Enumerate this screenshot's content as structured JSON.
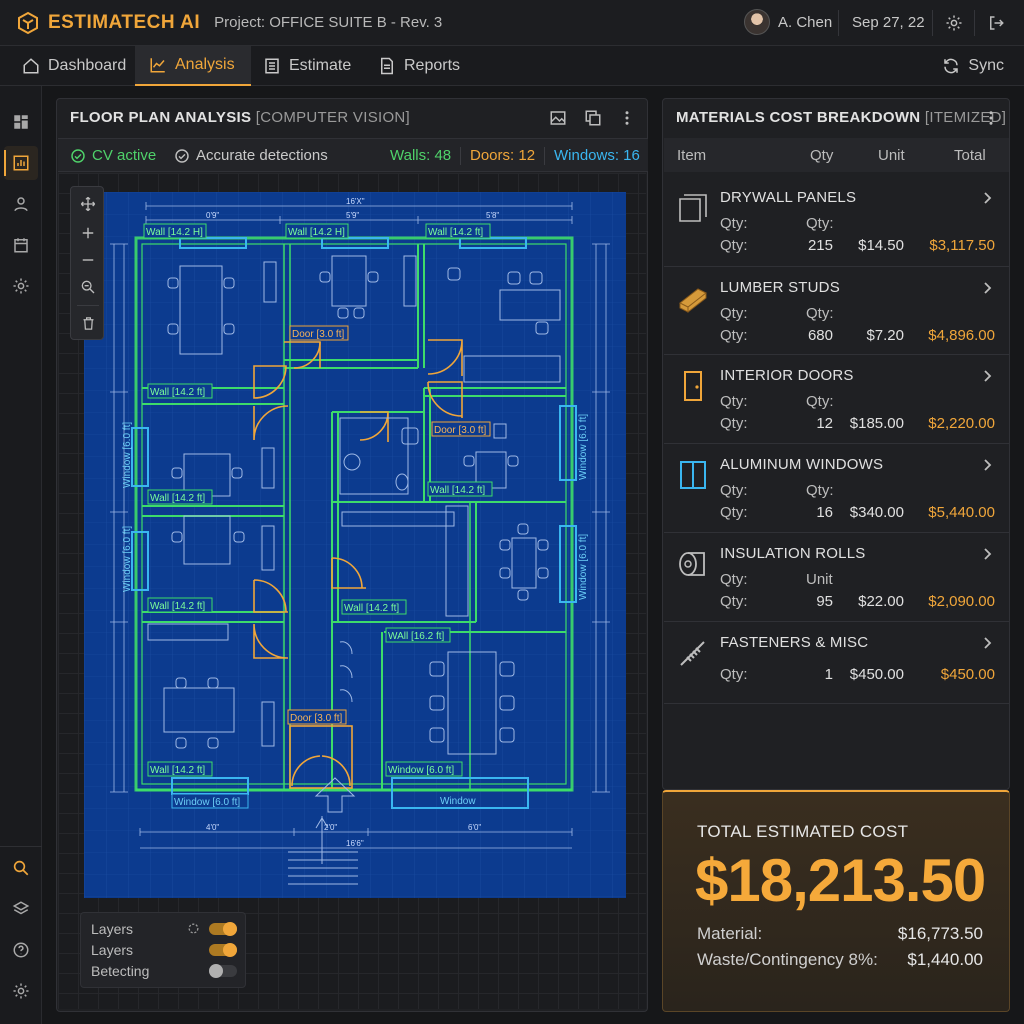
{
  "header": {
    "brand": "ESTIMATECH AI",
    "project": "Project: OFFICE SUITE B - Rev. 3",
    "user": "A. Chen",
    "date": "Sep 27, 22"
  },
  "nav": {
    "tabs": [
      {
        "label": "Dashboard",
        "icon": "home-icon"
      },
      {
        "label": "Analysis",
        "icon": "chart-line-icon",
        "active": true
      },
      {
        "label": "Estimate",
        "icon": "list-icon"
      },
      {
        "label": "Reports",
        "icon": "document-icon"
      }
    ],
    "sync": "Sync"
  },
  "plan_panel": {
    "title": "FLOOR PLAN ANALYSIS",
    "subtitle": "[COMPUTER VISION]",
    "status": {
      "cv": "CV active",
      "accuracy": "Accurate detections",
      "walls": "Walls: 48",
      "doors": "Doors: 12",
      "windows": "Windows: 16"
    },
    "dimensions": {
      "top_total": "16'X\"",
      "top_a": "0'9\"",
      "top_b": "5'9\"",
      "top_c": "5'8\"",
      "bottom_a": "4'0\"",
      "bottom_b": "2'0\"",
      "bottom_c": "6'0\"",
      "bottom_total": "16'6\""
    },
    "labels": {
      "wall_a": "Wall [14.2 H]",
      "wall_b": "Wall [14.2 H]",
      "wall_c": "Wall [14.2 ft]",
      "wall_d": "Wall [14.2 ft]",
      "wall_e": "Wall [14.2 ft]",
      "wall_f": "Wall [14.2 ft]",
      "wall_g": "Wall [14.2 ft]",
      "wall_h": "Wall [14.2 ft]",
      "wall_i": "Wall [14.2 ft]",
      "wall_j": "WAll [16.2 ft]",
      "wall_k": "Wall [14.2 ft]",
      "door_a": "Door [3.0 ft]",
      "door_b": "Door [3.0 ft]",
      "door_c": "Door [3.0 ft]",
      "window_a": "Window [6.0 ft]",
      "window_b": "Window",
      "window_c": "Window [6.0 ft]",
      "window_d": "Window [6.0 ft]",
      "window_e": "Window [6.0 ft]",
      "window_f": "Window [6.0 ft]",
      "window_g": "Window [6.0 ft]"
    },
    "layers": [
      {
        "label": "Layers",
        "on": true
      },
      {
        "label": "Layers",
        "on": true
      },
      {
        "label": "Betecting",
        "on": false
      }
    ]
  },
  "cost_panel": {
    "title": "MATERIALS COST BREAKDOWN",
    "subtitle": "[ITEMIZED]",
    "columns": {
      "item": "Item",
      "qty": "Qty",
      "unit": "Unit",
      "total": "Total"
    },
    "items": [
      {
        "name": "DRYWALL PANELS",
        "icon": "drywall-panel-icon",
        "r1a": "Qty:",
        "r1b": "Qty:",
        "r2a": "Qty:",
        "qty": "215",
        "unit": "$14.50",
        "total": "$3,117.50"
      },
      {
        "name": "LUMBER STUDS",
        "icon": "lumber-icon",
        "r1a": "Qty:",
        "r1b": "Qty:",
        "r2a": "Qty:",
        "qty": "680",
        "unit": "$7.20",
        "total": "$4,896.00"
      },
      {
        "name": "INTERIOR DOORS",
        "icon": "door-icon",
        "r1a": "Qty:",
        "r1b": "Qty:",
        "r2a": "Qty:",
        "qty": "12",
        "unit": "$185.00",
        "total": "$2,220.00"
      },
      {
        "name": "ALUMINUM WINDOWS",
        "icon": "window-icon",
        "r1a": "Qty:",
        "r1b": "Qty:",
        "r2a": "Qty:",
        "qty": "16",
        "unit": "$340.00",
        "total": "$5,440.00"
      },
      {
        "name": "INSULATION ROLLS",
        "icon": "insulation-roll-icon",
        "r1a": "Qty:",
        "r1b": "Unit",
        "r2a": "Qty:",
        "qty": "95",
        "unit": "$22.00",
        "total": "$2,090.00"
      },
      {
        "name": "FASTENERS & MISC",
        "icon": "screw-icon",
        "r1a": "",
        "r1b": "",
        "r2a": "Qty:",
        "qty": "1",
        "unit": "$450.00",
        "total": "$450.00"
      }
    ]
  },
  "total": {
    "label": "TOTAL ESTIMATED COST",
    "value": "$18,213.50",
    "material_label": "Material:",
    "material_value": "$16,773.50",
    "waste_label": "Waste/Contingency 8%:",
    "waste_value": "$1,440.00"
  },
  "colors": {
    "accent": "#f0a63a",
    "wall": "#3ddc6a",
    "window": "#3ab6f0",
    "door": "#f0a63a",
    "plan_bg": "#0c3b8f"
  }
}
